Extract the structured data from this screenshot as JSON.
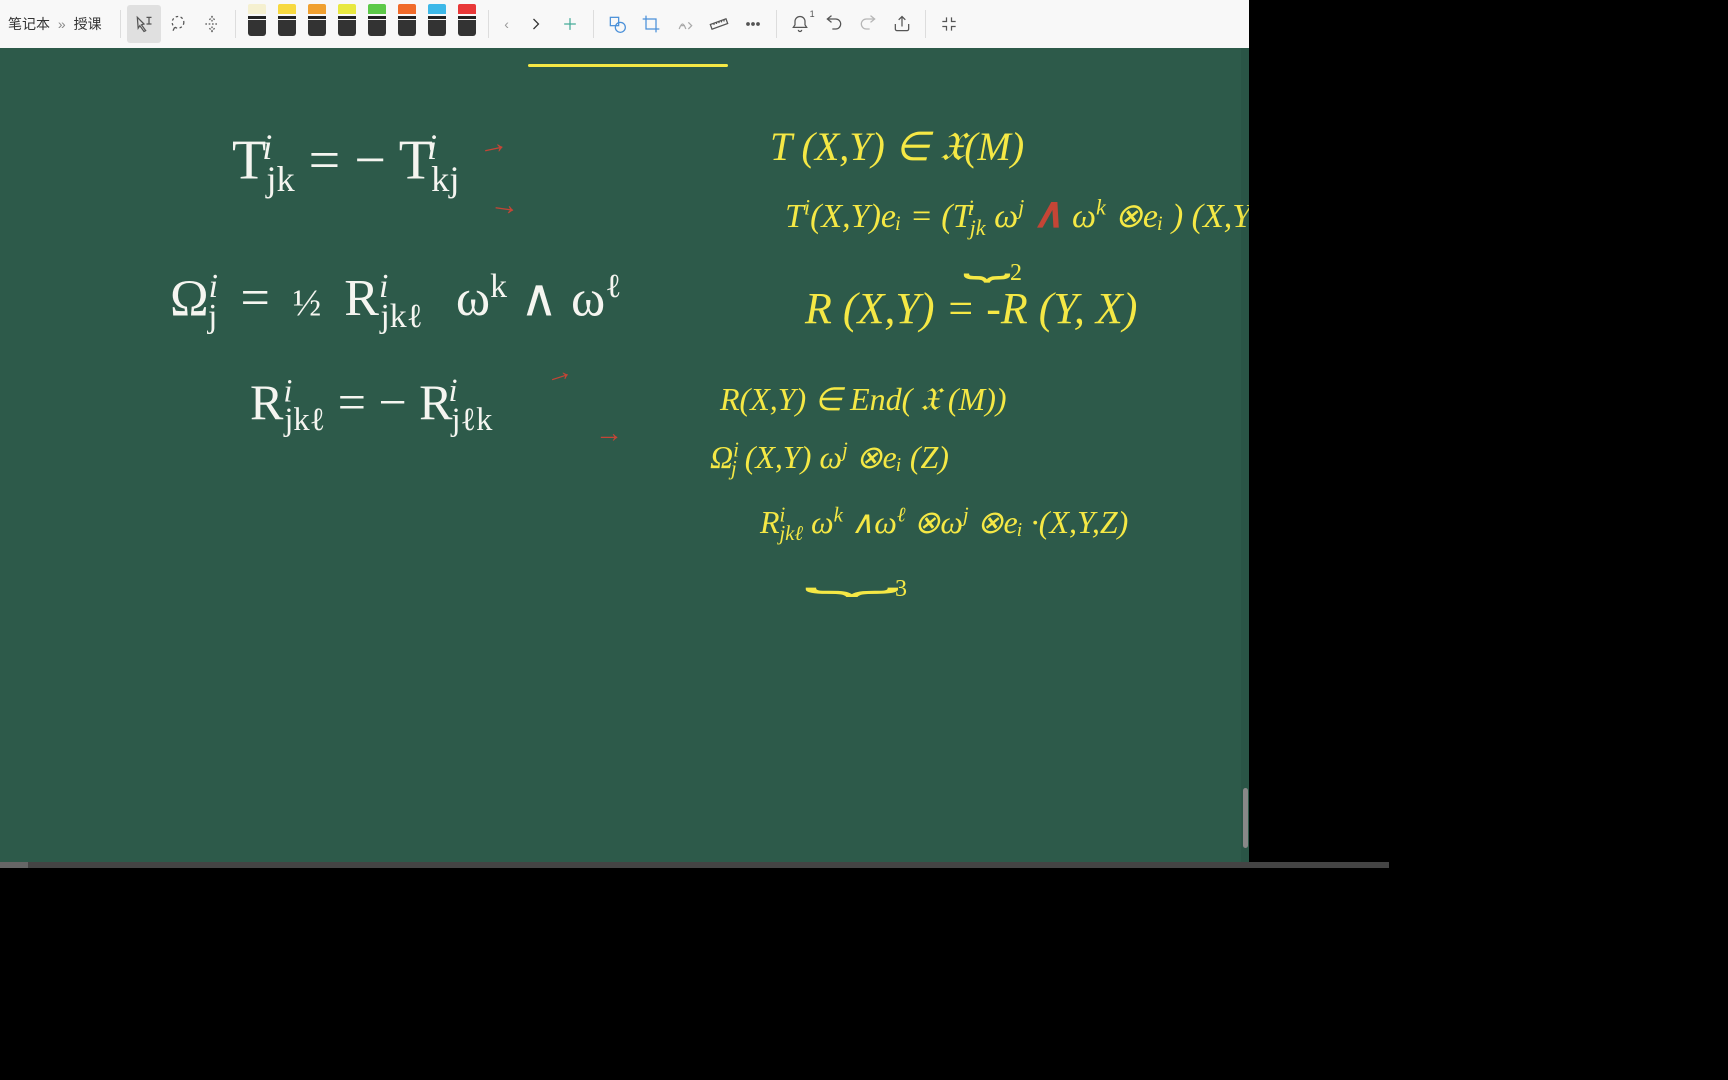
{
  "breadcrumb": {
    "part1": "笔记本",
    "sep": "»",
    "part2": "授课"
  },
  "toolbar": {
    "highlighters": [
      {
        "name": "white",
        "color": "#f5f0d0"
      },
      {
        "name": "yellow",
        "color": "#f7d940"
      },
      {
        "name": "amber",
        "color": "#f0a030"
      },
      {
        "name": "lime",
        "color": "#e8e840"
      },
      {
        "name": "green",
        "color": "#5cc948"
      },
      {
        "name": "orange",
        "color": "#f06a2a"
      },
      {
        "name": "cyan",
        "color": "#3db8e8"
      },
      {
        "name": "red",
        "color": "#e83838"
      }
    ],
    "notification_badge": "1"
  },
  "board": {
    "eq1": "T",
    "eq1b": "jk",
    "eq1c": "= −  T",
    "eq1d": "kj",
    "eq1sup": "i",
    "eq2a": "Ω",
    "eq2b": "j",
    "eq2c": "=",
    "eq2d": "½",
    "eq2e": "R",
    "eq2f": "jkℓ",
    "eq2g": "ω",
    "eq2h": "k",
    "eq2i": "∧ ω",
    "eq2j": "ℓ",
    "eq3a": "R",
    "eq3b": "jkℓ",
    "eq3c": "= −  R",
    "eq3d": "jℓk",
    "r1": "T (X,Y) ∈ 𝔛(M)",
    "r2a": "T",
    "r2a2": "(X,Y)eᵢ = (T",
    "r2b": "jk",
    "r2c": "ω",
    "r2d": "j",
    "r2e": "∧",
    "r2f": "ω",
    "r2g": "k",
    "r2h": "⊗eᵢ ) (X,Y)",
    "r2brace": "⏟",
    "r2bn": "2",
    "r3": "R (X,Y) = -R (Y, X)",
    "r4": "R(X,Y) ∈ End( 𝔛 (M))",
    "r5a": "Ω",
    "r5b": "j",
    "r5c": "(X,Y) ω",
    "r5d": "j",
    "r5e": "⊗eᵢ  (Z)",
    "r6a": "R",
    "r6b": "jkℓ",
    "r6c": " ω",
    "r6d": "k",
    "r6e": "∧ω",
    "r6f": "ℓ",
    "r6g": "⊗ω",
    "r6h": "j",
    "r6i": "⊗eᵢ",
    "r6j": "·(X,Y,Z)",
    "r6brace": "⏟",
    "r6bn": "3",
    "redA": "∧",
    "arrow1": "→",
    "arrow2": "→"
  }
}
